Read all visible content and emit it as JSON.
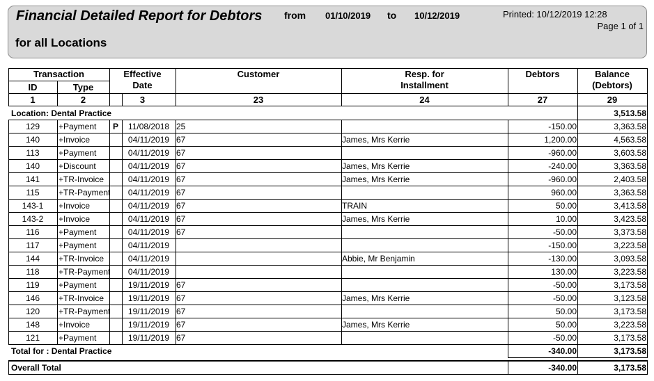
{
  "report": {
    "title": "Financial Detailed Report for Debtors",
    "from_label": "from",
    "from_date": "01/10/2019",
    "to_label": "to",
    "to_date": "10/12/2019",
    "printed": "Printed: 10/12/2019 12:28",
    "page": "Page 1 of 1",
    "subtitle": "for all Locations"
  },
  "columns": {
    "transaction": "Transaction",
    "id": "ID",
    "type": "Type",
    "effective": "Effective",
    "date": "Date",
    "customer": "Customer",
    "resp1": "Resp. for",
    "resp2": "Installment",
    "debtors": "Debtors",
    "balance1": "Balance",
    "balance2": "(Debtors)",
    "num_id": "1",
    "num_type": "2",
    "num_date": "3",
    "num_customer": "23",
    "num_resp": "24",
    "num_debtors": "27",
    "num_balance": "29"
  },
  "location": {
    "label": "Location: Dental Practice",
    "opening_balance": "3,513.58"
  },
  "rows": [
    {
      "id": "129",
      "type": "+Payment",
      "flag": "P",
      "date": "11/08/2018",
      "customer": "25",
      "resp": "",
      "debtors": "-150.00",
      "balance": "3,363.58"
    },
    {
      "id": "140",
      "type": "+Invoice",
      "flag": "",
      "date": "04/11/2019",
      "customer": "67",
      "resp": "James, Mrs Kerrie",
      "debtors": "1,200.00",
      "balance": "4,563.58"
    },
    {
      "id": "113",
      "type": "+Payment",
      "flag": "",
      "date": "04/11/2019",
      "customer": "67",
      "resp": "",
      "debtors": "-960.00",
      "balance": "3,603.58"
    },
    {
      "id": "140",
      "type": "+Discount",
      "flag": "",
      "date": "04/11/2019",
      "customer": "67",
      "resp": "James, Mrs Kerrie",
      "debtors": "-240.00",
      "balance": "3,363.58"
    },
    {
      "id": "141",
      "type": "+TR-Invoice",
      "flag": "",
      "date": "04/11/2019",
      "customer": "67",
      "resp": "James, Mrs Kerrie",
      "debtors": "-960.00",
      "balance": "2,403.58"
    },
    {
      "id": "115",
      "type": "+TR-Payment",
      "flag": "",
      "date": "04/11/2019",
      "customer": "67",
      "resp": "",
      "debtors": "960.00",
      "balance": "3,363.58"
    },
    {
      "id": "143-1",
      "type": "+Invoice",
      "flag": "",
      "date": "04/11/2019",
      "customer": "67",
      "resp": "TRAIN",
      "debtors": "50.00",
      "balance": "3,413.58"
    },
    {
      "id": "143-2",
      "type": "+Invoice",
      "flag": "",
      "date": "04/11/2019",
      "customer": "67",
      "resp": "James, Mrs Kerrie",
      "debtors": "10.00",
      "balance": "3,423.58"
    },
    {
      "id": "116",
      "type": "+Payment",
      "flag": "",
      "date": "04/11/2019",
      "customer": "67",
      "resp": "",
      "debtors": "-50.00",
      "balance": "3,373.58"
    },
    {
      "id": "117",
      "type": "+Payment",
      "flag": "",
      "date": "04/11/2019",
      "customer": "",
      "resp": "",
      "debtors": "-150.00",
      "balance": "3,223.58"
    },
    {
      "id": "144",
      "type": "+TR-Invoice",
      "flag": "",
      "date": "04/11/2019",
      "customer": "",
      "resp": "Abbie, Mr Benjamin",
      "debtors": "-130.00",
      "balance": "3,093.58"
    },
    {
      "id": "118",
      "type": "+TR-Payment",
      "flag": "",
      "date": "04/11/2019",
      "customer": "",
      "resp": "",
      "debtors": "130.00",
      "balance": "3,223.58"
    },
    {
      "id": "119",
      "type": "+Payment",
      "flag": "",
      "date": "19/11/2019",
      "customer": "67",
      "resp": "",
      "debtors": "-50.00",
      "balance": "3,173.58"
    },
    {
      "id": "146",
      "type": "+TR-Invoice",
      "flag": "",
      "date": "19/11/2019",
      "customer": "67",
      "resp": "James, Mrs Kerrie",
      "debtors": "-50.00",
      "balance": "3,123.58"
    },
    {
      "id": "120",
      "type": "+TR-Payment",
      "flag": "",
      "date": "19/11/2019",
      "customer": "67",
      "resp": "",
      "debtors": "50.00",
      "balance": "3,173.58"
    },
    {
      "id": "148",
      "type": "+Invoice",
      "flag": "",
      "date": "19/11/2019",
      "customer": "67",
      "resp": "James, Mrs Kerrie",
      "debtors": "50.00",
      "balance": "3,223.58"
    },
    {
      "id": "121",
      "type": "+Payment",
      "flag": "",
      "date": "19/11/2019",
      "customer": "67",
      "resp": "",
      "debtors": "-50.00",
      "balance": "3,173.58"
    }
  ],
  "total": {
    "label": "Total for : Dental Practice",
    "debtors": "-340.00",
    "balance": "3,173.58"
  },
  "overall": {
    "label": "Overall Total",
    "debtors": "-340.00",
    "balance": "3,173.58"
  }
}
